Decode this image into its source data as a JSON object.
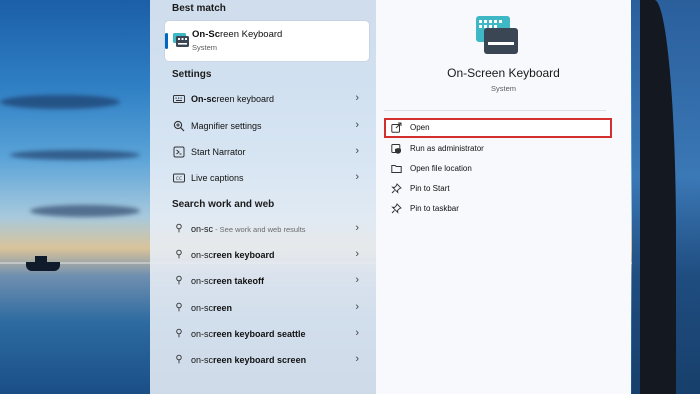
{
  "best_match": {
    "section_title": "Best match",
    "app_name_prefix": "On-Sc",
    "app_name_rest": "reen Keyboard",
    "app_type": "System"
  },
  "settings": {
    "section_title": "Settings",
    "items": [
      {
        "bold": "On-sc",
        "rest": "reen keyboard",
        "icon": "keyboard-icon"
      },
      {
        "bold": "",
        "rest": "Magnifier settings",
        "icon": "magnifier-icon"
      },
      {
        "bold": "",
        "rest": "Start Narrator",
        "icon": "narrator-icon"
      },
      {
        "bold": "",
        "rest": "Live captions",
        "icon": "captions-icon"
      }
    ]
  },
  "web": {
    "section_title": "Search work and web",
    "items": [
      {
        "plain": "on-sc",
        "bold": "",
        "hint": " - See work and web results"
      },
      {
        "plain": "on-sc",
        "bold": "reen keyboard",
        "hint": ""
      },
      {
        "plain": "on-sc",
        "bold": "reen takeoff",
        "hint": ""
      },
      {
        "plain": "on-sc",
        "bold": "reen",
        "hint": ""
      },
      {
        "plain": "on-sc",
        "bold": "reen keyboard seattle",
        "hint": ""
      },
      {
        "plain": "on-sc",
        "bold": "reen keyboard screen",
        "hint": ""
      }
    ]
  },
  "detail": {
    "title": "On-Screen Keyboard",
    "subtitle": "System",
    "actions": [
      {
        "label": "Open",
        "icon": "open-external-icon"
      },
      {
        "label": "Run as administrator",
        "icon": "shield-admin-icon"
      },
      {
        "label": "Open file location",
        "icon": "folder-icon"
      },
      {
        "label": "Pin to Start",
        "icon": "pin-icon"
      },
      {
        "label": "Pin to taskbar",
        "icon": "pin-icon"
      }
    ]
  },
  "colors": {
    "accent": "#0067c0",
    "highlight_border": "#d32f2f",
    "icon_teal": "#3fb8c6",
    "icon_dark": "#3a4654"
  }
}
